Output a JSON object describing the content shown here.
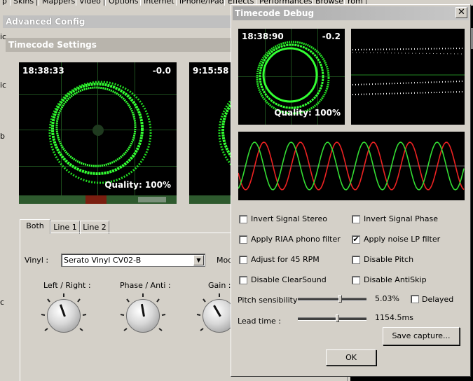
{
  "top_tabs": [
    "p",
    "Skins",
    "Mappers",
    "Video",
    "Options",
    "Internet",
    "iPhone/iPad",
    "Effects",
    "Performances",
    "Browser",
    "rom"
  ],
  "side_fragments": [
    "ic",
    "ic",
    "b",
    "c"
  ],
  "advanced_config": {
    "title": "Advanced Config",
    "timecode_title": "Timecode Settings",
    "scope_left": {
      "time": "18:38:33",
      "offset": "-0.0",
      "quality": "Quality: 100%"
    },
    "scope_right": {
      "time": "9:15:58"
    },
    "tabs": [
      "Both",
      "Line 1",
      "Line 2"
    ],
    "vinyl_label": "Vinyl :",
    "vinyl_value": "Serato Vinyl CV02-B",
    "mode_label_fragment": "Mod",
    "knobs": [
      {
        "label": "Left / Right :"
      },
      {
        "label": "Phase / Anti :"
      },
      {
        "label": "Gain :"
      }
    ]
  },
  "timecode_debug": {
    "title": "Timecode Debug",
    "close_label": "✕",
    "scope": {
      "time": "18:38:90",
      "offset": "-0.2",
      "quality": "Quality: 100%"
    },
    "options_left": [
      {
        "label": "Invert Signal Stereo",
        "checked": false
      },
      {
        "label": "Apply RIAA phono filter",
        "checked": false
      },
      {
        "label": "Adjust for 45 RPM",
        "checked": false
      },
      {
        "label": "Disable ClearSound",
        "checked": false
      }
    ],
    "options_right": [
      {
        "label": "Invert Signal Phase",
        "checked": false
      },
      {
        "label": "Apply noise LP filter",
        "checked": true
      },
      {
        "label": "Disable Pitch",
        "checked": false
      },
      {
        "label": "Disable AntiSkip",
        "checked": false
      }
    ],
    "pitch_label": "Pitch sensibility",
    "pitch_value": "5.03%",
    "pitch_fraction": 0.62,
    "delayed_label": "Delayed",
    "delayed_checked": false,
    "lead_label": "Lead time :",
    "lead_value": "1154.5ms",
    "lead_fraction": 0.58,
    "save_button": "Save capture...",
    "ok_button": "OK"
  },
  "colors": {
    "scope_green": "#33ff33",
    "wave_red": "#ee2222",
    "wave_green": "#33dd33"
  }
}
